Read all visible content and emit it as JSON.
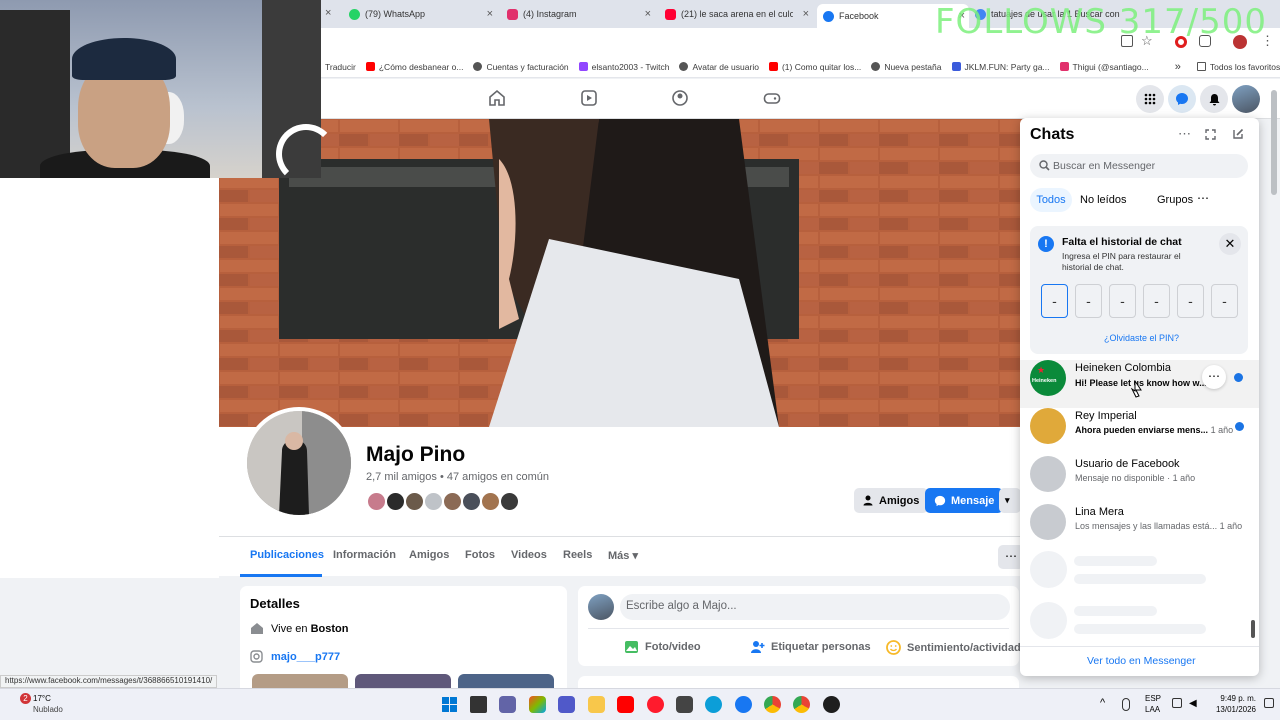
{
  "browser": {
    "tabs": [
      {
        "label": "(79) WhatsApp",
        "color": "#25d366"
      },
      {
        "label": "(4) Instagram",
        "color": "#e1306c"
      },
      {
        "label": "(21) le saca arena en el culo a u",
        "color": "#ff0033"
      },
      {
        "label": "Facebook",
        "color": "#1877f2"
      },
      {
        "label": "tatuajes de usar la 1 Buscar con",
        "color": "#4285f4"
      }
    ],
    "overlay_text": "FOLLOWS 317/500",
    "bookmarks": [
      {
        "label": "Traducir"
      },
      {
        "label": "¿Cómo desbanear o...",
        "color": "#ff0000"
      },
      {
        "label": "Cuentas y facturación",
        "color": "#555555"
      },
      {
        "label": "elsanto2003 - Twitch",
        "color": "#9146ff"
      },
      {
        "label": "Avatar de usuario",
        "color": "#555555"
      },
      {
        "label": "(1) Como quitar los...",
        "color": "#ff0000"
      },
      {
        "label": "Nueva pestaña",
        "color": "#555555"
      },
      {
        "label": "JKLM.FUN: Party ga...",
        "color": "#3b5bdb"
      },
      {
        "label": "Thigui (@santiago...",
        "color": "#e1306c"
      }
    ],
    "favorites_label": "Todos los favoritos"
  },
  "profile": {
    "name": "Majo Pino",
    "friends": "2,7 mil amigos • 47 amigos en común",
    "friends_button": "Amigos",
    "message_button": "Mensaje",
    "tabs": [
      "Publicaciones",
      "Información",
      "Amigos",
      "Fotos",
      "Videos",
      "Reels",
      "Más"
    ]
  },
  "details": {
    "title": "Detalles",
    "lives_prefix": "Vive en",
    "lives_city": "Boston",
    "instagram": "majo___p777"
  },
  "composer": {
    "placeholder": "Escribe algo a Majo...",
    "actions": [
      "Foto/video",
      "Etiquetar personas",
      "Sentimiento/actividad"
    ]
  },
  "chats": {
    "title": "Chats",
    "search_placeholder": "Buscar en Messenger",
    "filters": [
      "Todos",
      "No leídos",
      "Grupos"
    ],
    "pin_title": "Falta el historial de chat",
    "pin_body": "Ingresa el PIN para restaurar el historial de chat.",
    "pin_forgot": "¿Olvidaste el PIN?",
    "pin_placeholder": "-",
    "conversations": [
      {
        "name": "Heineken Colombia",
        "message": "Hi! Please let us know how w...",
        "time": "",
        "unread": true
      },
      {
        "name": "Rey Imperial",
        "message": "Ahora pueden enviarse mens...",
        "time": "1 año",
        "unread": true
      },
      {
        "name": "Usuario de Facebook",
        "message": "Mensaje no disponible",
        "time": "1 año",
        "unread": false
      },
      {
        "name": "Lina Mera",
        "message": "Los mensajes y las llamadas está...",
        "time": "1 año",
        "unread": false
      }
    ],
    "heineken_logo_text": "Heineken",
    "footer": "Ver todo en Messenger"
  },
  "status_url": "https://www.facebook.com/messages/t/368866510191410/",
  "taskbar": {
    "weather_temp": "17°C",
    "weather_desc": "Nublado",
    "weather_badge": "2",
    "lang_top": "ESP",
    "lang_bottom": "LAA",
    "time": "9:49 p. m.",
    "date": "13/01/2026"
  }
}
